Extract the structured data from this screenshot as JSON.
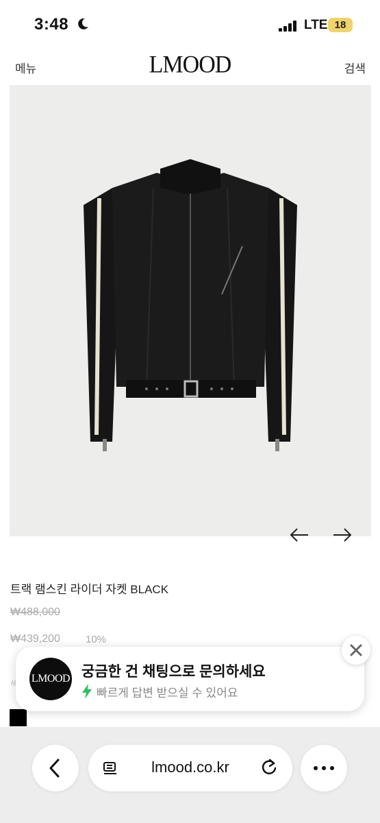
{
  "status_bar": {
    "time": "3:48",
    "network": "LTE",
    "battery": "18"
  },
  "header": {
    "menu": "메뉴",
    "logo": "LMOOD",
    "search": "검색"
  },
  "product": {
    "name": "트랙 램스킨 라이더 자켓 BLACK",
    "price_original": "₩488,000",
    "price_sale": "₩439,200",
    "discount": "10%",
    "faded_label": "색상",
    "swatch_color": "#000000"
  },
  "chat": {
    "logo": "LMOOD",
    "title": "궁금한 건 채팅으로 문의하세요",
    "subtitle": "빠르게 답변 받으실 수 있어요"
  },
  "browser": {
    "url": "lmood.co.kr"
  }
}
